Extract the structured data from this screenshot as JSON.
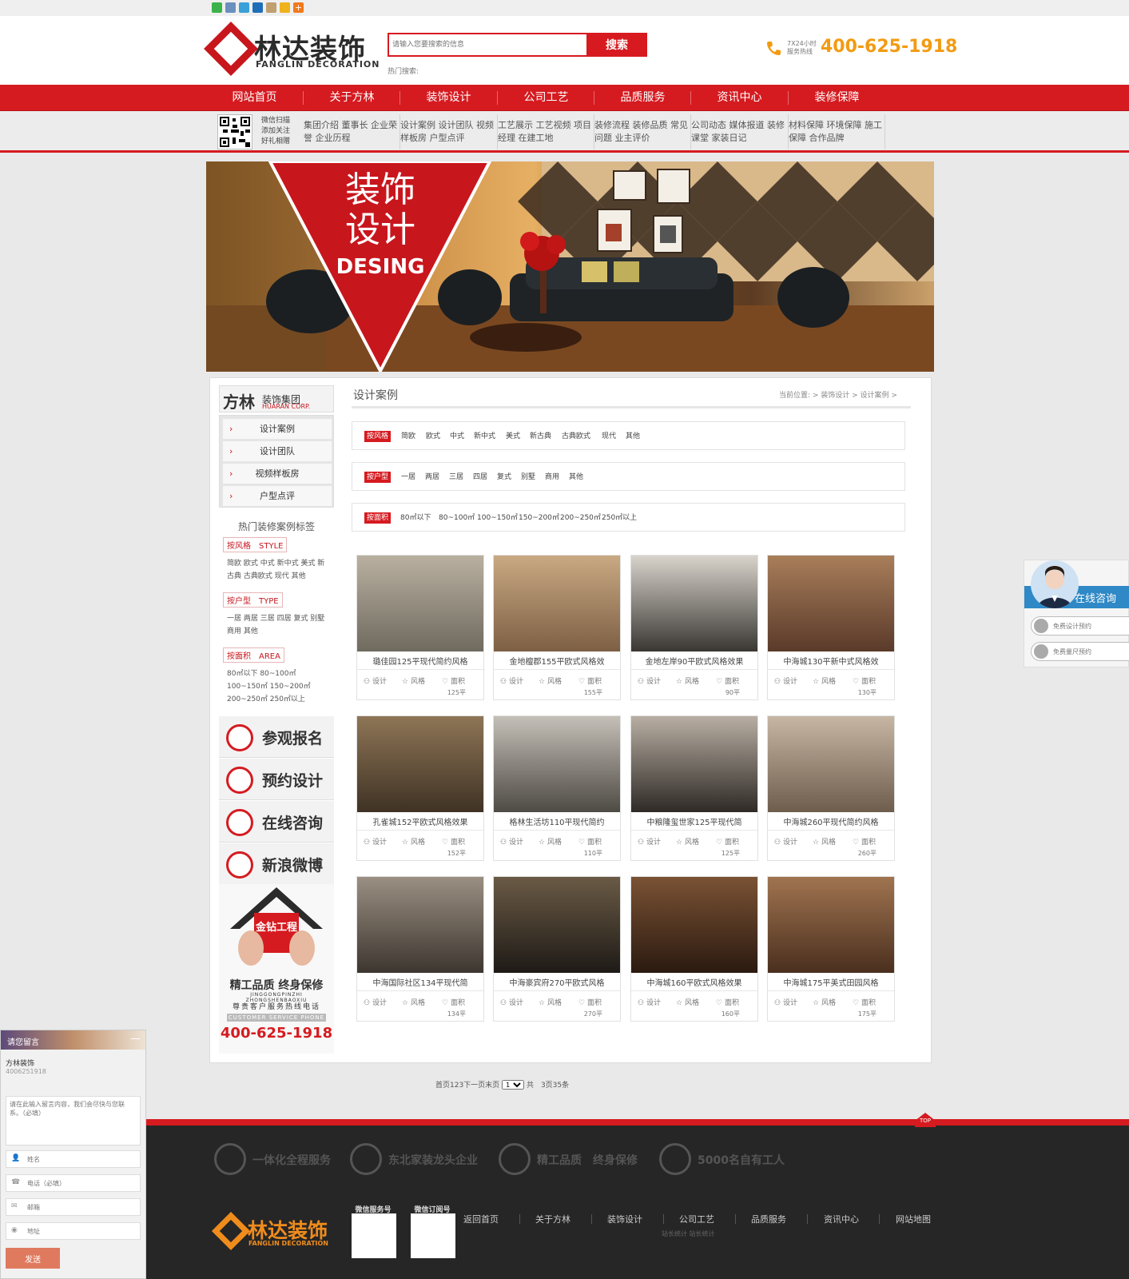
{
  "share_icons": [
    "wechat-icon",
    "qq-space-icon",
    "sina-weibo-icon",
    "renren-icon",
    "douban-icon",
    "bookmark-icon",
    "more-icon"
  ],
  "header": {
    "logo_cn": "林达装饰",
    "logo_en": "FANGLIN DECORATION",
    "search_placeholder": "请输入您要搜索的信息",
    "search_button": "搜索",
    "hot_search_label": "热门搜索:",
    "phone_sub": "7X24小时 服务热线",
    "phone": "400-625-1918"
  },
  "main_nav": [
    "网站首页",
    "关于方林",
    "装饰设计",
    "公司工艺",
    "品质服务",
    "资讯中心",
    "装修保障"
  ],
  "sub_nav": {
    "qr_text": "微信扫描 添加关注 好礼相赠",
    "columns": [
      [
        "集团介绍",
        "董事长",
        "企业荣誉",
        "企业历程"
      ],
      [
        "设计案例",
        "设计团队",
        "视频样板房",
        "户型点评"
      ],
      [
        "工艺展示",
        "工艺视频",
        "项目经理",
        "在建工地"
      ],
      [
        "装修流程",
        "装修品质",
        "常见问题",
        "业主评价"
      ],
      [
        "公司动态",
        "媒体报道",
        "装修课堂",
        "家装日记"
      ],
      [
        "材料保障",
        "环境保障",
        "施工保障",
        "合作品牌"
      ]
    ]
  },
  "banner": {
    "title_line1": "装饰",
    "title_line2": "设计",
    "title_en": "DESING"
  },
  "sidebar": {
    "brand_big": "方林",
    "brand_small": "装饰集团",
    "brand_en": "HUARAN CORP.",
    "menu": [
      "设计案例",
      "设计团队",
      "视频样板房",
      "户型点评"
    ],
    "hot_title": "热门装修案例标签",
    "style_head": "按风格　STYLE",
    "style_tags": "简欧 欧式 中式 新中式 美式 新古典 古典欧式 现代 其他",
    "type_head": "按户型　TYPE",
    "type_tags": "一居 两居 三居 四居 复式 别墅 商用 其他",
    "area_head": "按面积　AREA",
    "area_tags": "80㎡以下 80~100㎡ 100~150㎡ 150~200㎡ 200~250㎡ 250㎡以上",
    "buttons": [
      "参观报名",
      "预约设计",
      "在线咨询",
      "新浪微博"
    ],
    "promo_badge": "金钻工程",
    "promo_slogan": "精工品质 终身保修",
    "promo_pinyin": "JINGGONGPINZHI ZHONGSHENBAOXIU",
    "promo_hotline_label": "尊贵客户服务热线电话",
    "promo_hotline_en": "CUSTOMER SERVICE PHONE",
    "promo_phone": "400-625-1918"
  },
  "main": {
    "title": "设计案例",
    "breadcrumb": "当前位置: > 装饰设计 > 设计案例 >",
    "filters": [
      {
        "label": "按风格",
        "options": [
          "简欧",
          "欧式",
          "中式",
          "新中式",
          "美式",
          "新古典",
          "古典欧式",
          "现代",
          "其他"
        ]
      },
      {
        "label": "按户型",
        "options": [
          "一居",
          "两居",
          "三居",
          "四居",
          "复式",
          "别墅",
          "商用",
          "其他"
        ]
      },
      {
        "label": "按面积",
        "options": [
          "80㎡以下",
          "80~100㎡",
          "100~150㎡",
          "150~200㎡",
          "200~250㎡",
          "250㎡以上"
        ]
      }
    ],
    "meta_labels": {
      "design": "设计",
      "style": "风格",
      "area": "面积"
    },
    "cases": [
      {
        "title": "璐佳园125平现代简约风格",
        "area": "125平",
        "c1": "#b9b0a0",
        "c2": "#6f6a5f"
      },
      {
        "title": "金地檀郡155平欧式风格效",
        "area": "155平",
        "c1": "#c9a982",
        "c2": "#7d5f44"
      },
      {
        "title": "金地左岸90平欧式风格效果",
        "area": "90平",
        "c1": "#d8d4cc",
        "c2": "#3a3632"
      },
      {
        "title": "中海城130平新中式风格效",
        "area": "130平",
        "c1": "#a97e5a",
        "c2": "#5a3a2a"
      },
      {
        "title": "孔雀城152平欧式风格效果",
        "area": "152平",
        "c1": "#8e7556",
        "c2": "#3f3224"
      },
      {
        "title": "格林生活坊110平现代简约",
        "area": "110平",
        "c1": "#c4c0b8",
        "c2": "#4e4a44"
      },
      {
        "title": "中粮隆玺世家125平现代简",
        "area": "125平",
        "c1": "#b8aea3",
        "c2": "#2f2a26"
      },
      {
        "title": "中海城260平现代简约风格",
        "area": "260平",
        "c1": "#c7b6a4",
        "c2": "#6e5d4c"
      },
      {
        "title": "中海国际社区134平现代简",
        "area": "134平",
        "c1": "#9a8f82",
        "c2": "#3d3630"
      },
      {
        "title": "中海豪宾府270平欧式风格",
        "area": "270平",
        "c1": "#6a5a45",
        "c2": "#1e1a16"
      },
      {
        "title": "中海城160平欧式风格效果",
        "area": "160平",
        "c1": "#7a5234",
        "c2": "#2b1a10"
      },
      {
        "title": "中海城175平美式田园风格",
        "area": "175平",
        "c1": "#a07450",
        "c2": "#4a2f1e"
      }
    ],
    "pager": "首页123下一页末页",
    "pager_select": "1",
    "pager_total": "共　3页35条"
  },
  "footer": {
    "features": [
      "一体化全程服务",
      "东北家装龙头企业",
      "精工品质　终身保修",
      "5000名自有工人"
    ],
    "logo_cn": "林达装饰",
    "logo_en": "FANGLIN DECORATION",
    "qr1_label": "微信服务号",
    "qr2_label": "微信订阅号",
    "links": [
      "返回首页",
      "关于方林",
      "装饰设计",
      "公司工艺",
      "品质服务",
      "资讯中心",
      "网站地图"
    ],
    "stat": "站长统计  站长统计",
    "top": "TOP"
  },
  "float_consult": {
    "title": "在线咨询",
    "opt1": "免费设计预约",
    "opt2": "免费量尺预约"
  },
  "message_widget": {
    "title": "请您留言",
    "close": "—",
    "company": "方林装饰",
    "company_phone": "4006251918",
    "textarea_placeholder": "请在此输入留言内容，我们会尽快与您联系。（必填）",
    "name_placeholder": "姓名",
    "phone_placeholder": "电话（必填）",
    "email_placeholder": "邮箱",
    "address_placeholder": "地址",
    "send": "发送"
  },
  "colors": {
    "brand_red": "#d51b20",
    "phone_orange": "#f29b12",
    "footer_orange": "#f08c1c",
    "consult_blue": "#2f89c6"
  }
}
